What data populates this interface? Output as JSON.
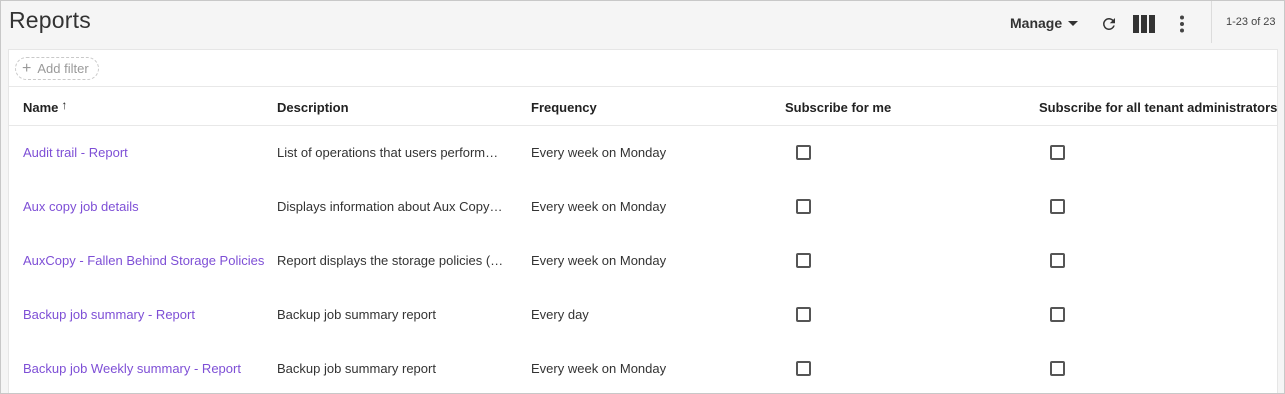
{
  "header": {
    "title": "Reports",
    "manage_label": "Manage",
    "paging": "1-23 of 23"
  },
  "toolbar": {
    "refresh_icon": "refresh-icon",
    "columns_icon": "columns-icon",
    "more_icon": "more-vertical-icon"
  },
  "filter": {
    "add_filter_label": "Add filter",
    "plus_glyph": "+"
  },
  "columns": {
    "name": "Name",
    "sort_glyph": "↑",
    "description": "Description",
    "frequency": "Frequency",
    "subscribe_me": "Subscribe for me",
    "subscribe_all": "Subscribe for all tenant administrators"
  },
  "rows": [
    {
      "name": "Audit trail - Report",
      "description": "List of operations that users perform…",
      "frequency": "Every week on Monday",
      "subscribe_me": false,
      "subscribe_all": false
    },
    {
      "name": "Aux copy job details",
      "description": "Displays information about Aux Copy…",
      "frequency": "Every week on Monday",
      "subscribe_me": false,
      "subscribe_all": false
    },
    {
      "name": "AuxCopy - Fallen Behind Storage Policies",
      "description": "Report displays the storage policies (…",
      "frequency": "Every week on Monday",
      "subscribe_me": false,
      "subscribe_all": false
    },
    {
      "name": "Backup job summary - Report",
      "description": "Backup job summary report",
      "frequency": "Every day",
      "subscribe_me": false,
      "subscribe_all": false
    },
    {
      "name": "Backup job Weekly summary - Report",
      "description": "Backup job summary report",
      "frequency": "Every week on Monday",
      "subscribe_me": false,
      "subscribe_all": false
    }
  ],
  "colors": {
    "link": "#7e4fd6",
    "border": "#c8c8c8",
    "header_bg": "#f5f5f5"
  }
}
